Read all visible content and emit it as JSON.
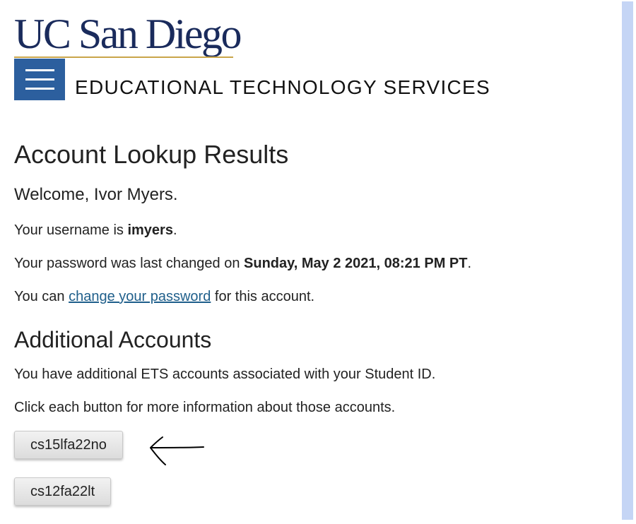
{
  "header": {
    "logo_text": "UC San Diego",
    "org_name": "EDUCATIONAL TECHNOLOGY SERVICES",
    "menu_icon": "hamburger-icon"
  },
  "main": {
    "title": "Account Lookup Results",
    "welcome": "Welcome, Ivor Myers.",
    "username_prefix": "Your username is ",
    "username": "imyers",
    "username_suffix": ".",
    "password_prefix": "Your password was last changed on ",
    "password_date": "Sunday, May 2 2021, 08:21 PM PT",
    "password_suffix": ".",
    "change_prefix": "You can ",
    "change_link": "change your password",
    "change_suffix": " for this account."
  },
  "additional": {
    "title": "Additional Accounts",
    "line1": "You have additional ETS accounts associated with your Student ID.",
    "line2": "Click each button for more information about those accounts.",
    "accounts": [
      "cs15lfa22no",
      "cs12fa22lt"
    ]
  },
  "annotation": {
    "icon": "hand-drawn-arrow-icon"
  },
  "colors": {
    "brand_navy": "#1a2b5c",
    "brand_gold": "#c9a54a",
    "menu_blue": "#2c5f9e",
    "link": "#1f5f8b",
    "scroll_track": "#c5d5f5"
  }
}
